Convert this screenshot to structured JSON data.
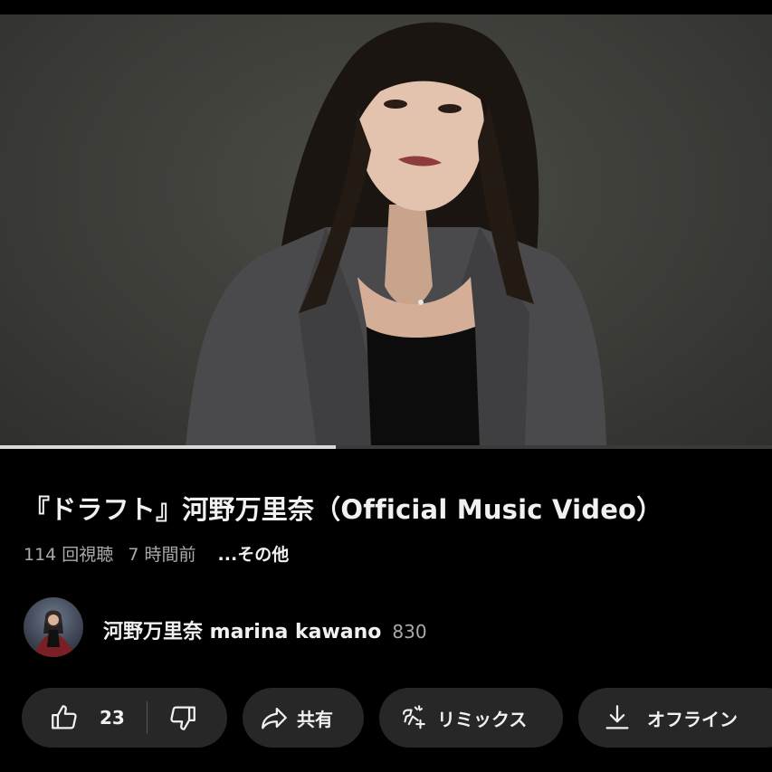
{
  "video": {
    "title": "『ドラフト』河野万里奈（Official Music Video）",
    "progress_fraction": 0.435
  },
  "meta": {
    "views": "114 回視聴",
    "age": "7 時間前",
    "more": "...その他"
  },
  "channel": {
    "name": "河野万里奈 marina kawano",
    "subscribers": "830"
  },
  "actions": {
    "like_count": "23",
    "share_label": "共有",
    "remix_label": "リミックス",
    "offline_label": "オフライン"
  },
  "icons": {
    "like": "thumbs-up-icon",
    "dislike": "thumbs-down-icon",
    "share": "share-arrow-icon",
    "remix": "remix-icon",
    "download": "download-icon"
  },
  "colors": {
    "background": "#000000",
    "pill": "#272727",
    "text_primary": "#f1f1f1",
    "text_secondary": "#aaaaaa",
    "progress": "#d9d9d9"
  }
}
